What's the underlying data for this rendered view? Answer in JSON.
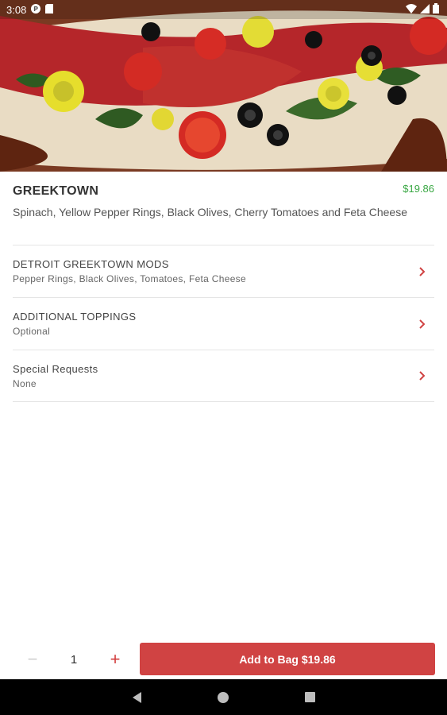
{
  "status_bar": {
    "time": "3:08",
    "icons": [
      "parking-icon",
      "sd-card-icon",
      "wifi-icon",
      "signal-icon",
      "battery-icon"
    ]
  },
  "item": {
    "name": "GREEKTOWN",
    "price": "$19.86",
    "description": "Spinach, Yellow Pepper Rings, Black Olives, Cherry Tomatoes and Feta Cheese"
  },
  "options": [
    {
      "title": "DETROIT GREEKTOWN MODS",
      "subtitle": "Pepper Rings, Black Olives, Tomatoes, Feta Cheese"
    },
    {
      "title": "ADDITIONAL TOPPINGS",
      "subtitle": "Optional"
    },
    {
      "title": "Special Requests",
      "subtitle": "None"
    }
  ],
  "cart": {
    "minus": "−",
    "quantity": "1",
    "plus": "+",
    "add_label": "Add to Bag $19.86"
  },
  "colors": {
    "accent_red": "#d04343",
    "price_green": "#3aa844"
  }
}
